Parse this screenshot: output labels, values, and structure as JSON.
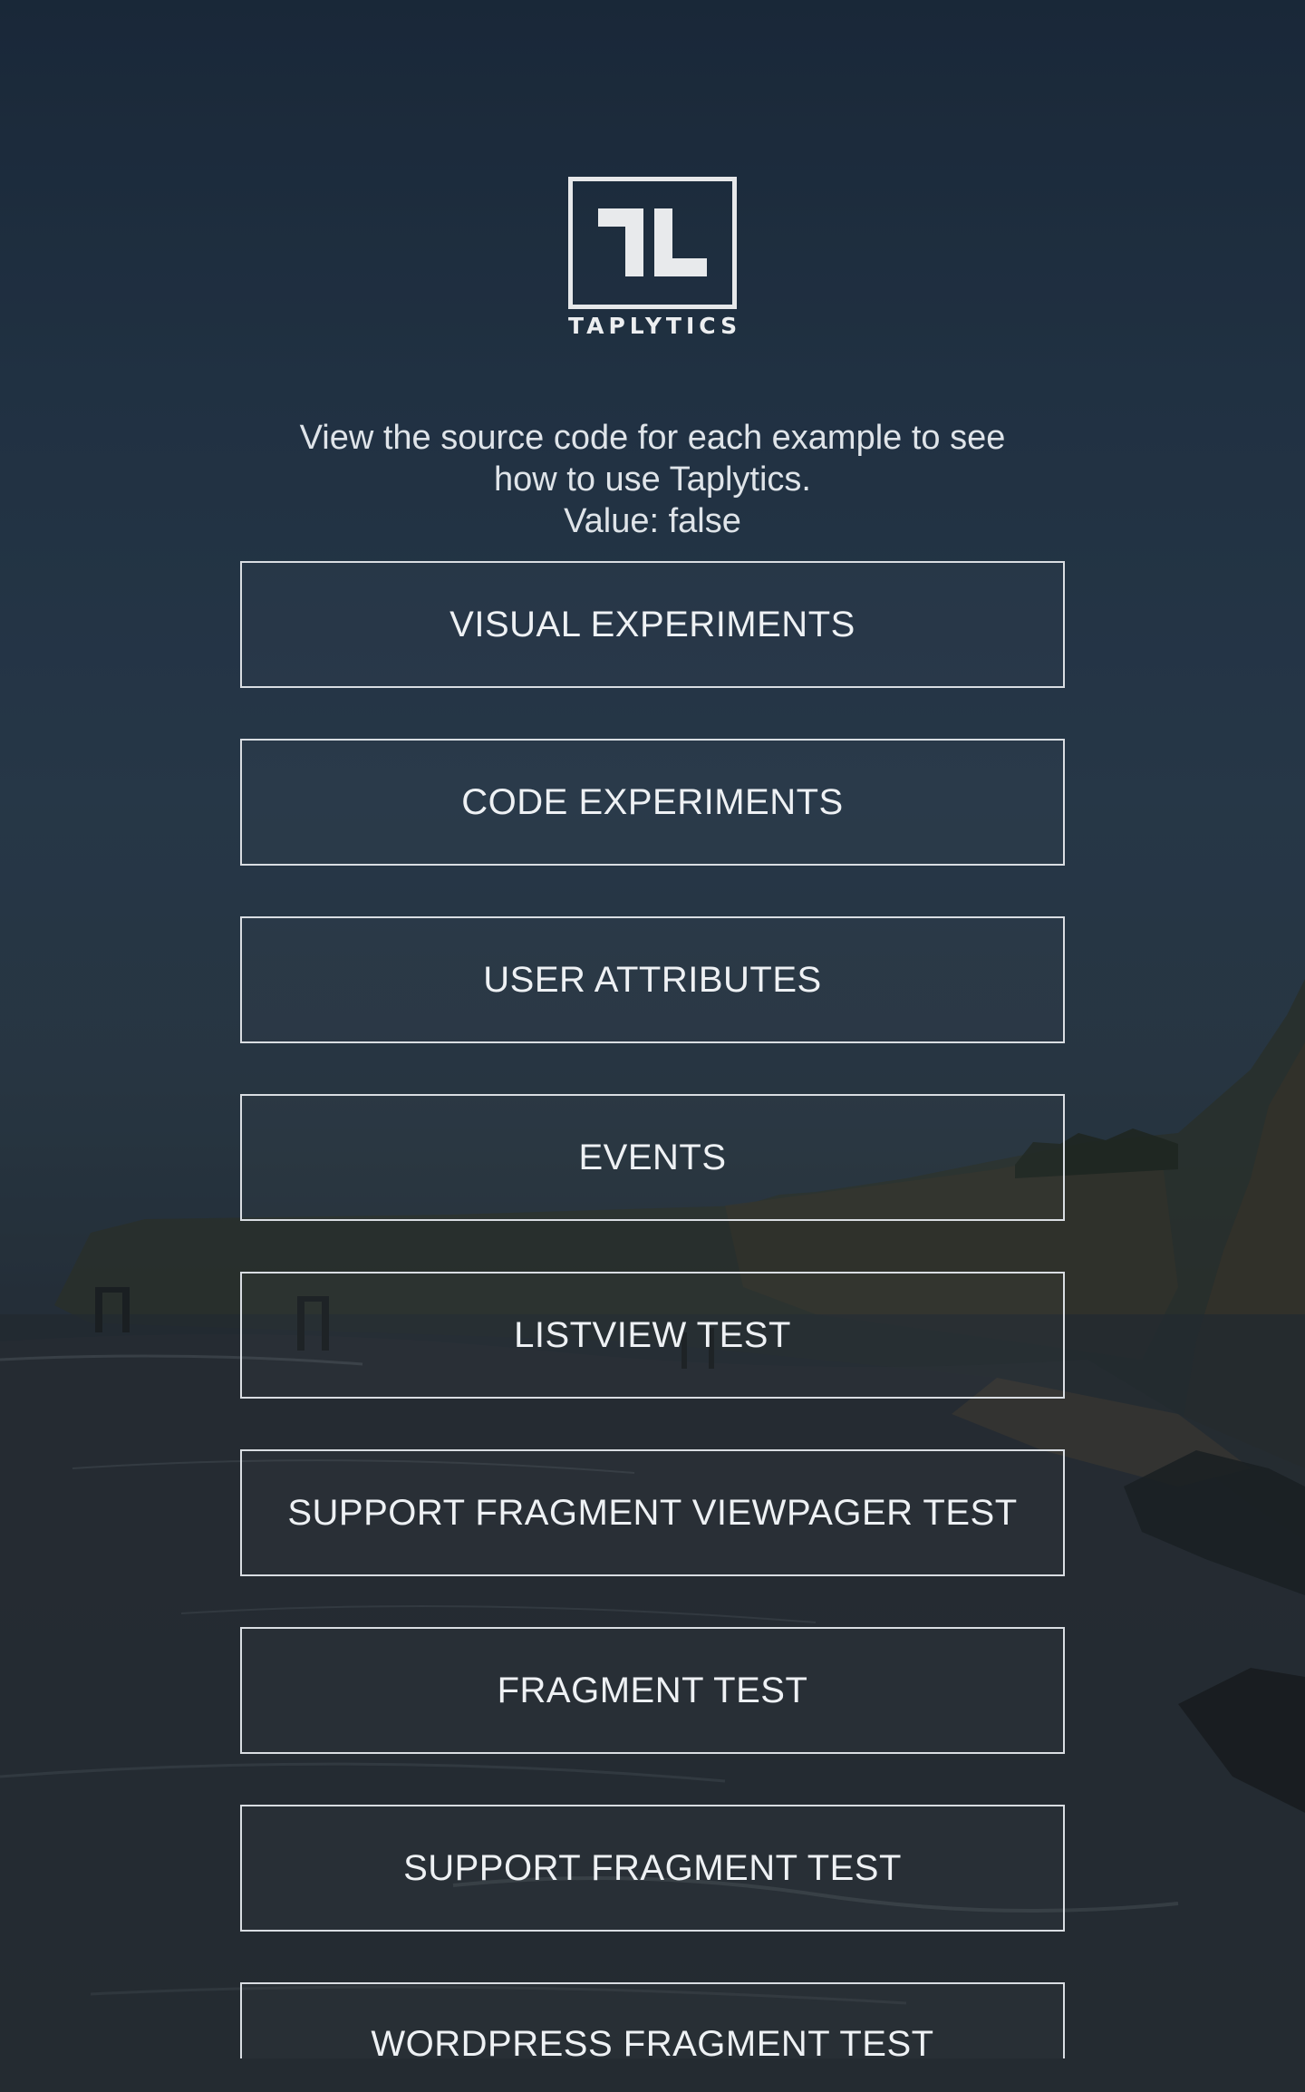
{
  "app": {
    "brand_name": "TAPLYTICS",
    "logo_icon": "taplytics-tl-logo"
  },
  "intro": {
    "line1": "View the source code for each example to see",
    "line2": "how to use Taplytics.",
    "value_line": "Value: false"
  },
  "buttons": [
    {
      "label": "VISUAL EXPERIMENTS"
    },
    {
      "label": "CODE EXPERIMENTS"
    },
    {
      "label": "USER ATTRIBUTES"
    },
    {
      "label": "EVENTS"
    },
    {
      "label": "LISTVIEW TEST"
    },
    {
      "label": "SUPPORT FRAGMENT VIEWPAGER TEST"
    },
    {
      "label": "FRAGMENT TEST"
    },
    {
      "label": "SUPPORT FRAGMENT TEST"
    },
    {
      "label": "WORDPRESS FRAGMENT TEST"
    }
  ],
  "colors": {
    "background_top": "#19283a",
    "background_bottom": "#1f252b",
    "foreground": "#e9edf1",
    "button_border": "#d9dde2"
  }
}
